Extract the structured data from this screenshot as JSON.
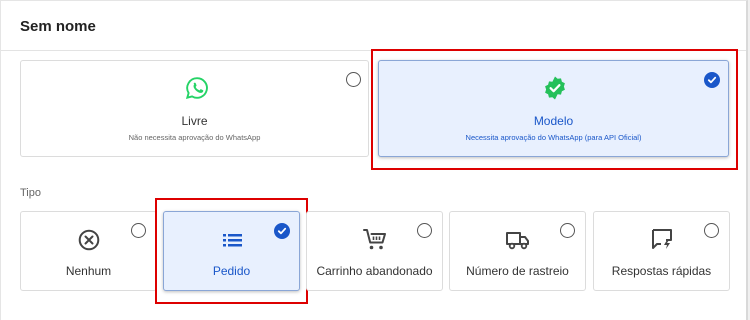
{
  "dialog": {
    "title": "Sem nome"
  },
  "mode_options": [
    {
      "label": "Livre",
      "description": "Não necessita aprovação do WhatsApp",
      "icon": "whatsapp-icon",
      "selected": false
    },
    {
      "label": "Modelo",
      "description": "Necessita aprovação do WhatsApp (para API Oficial)",
      "icon": "verified-badge-icon",
      "selected": true
    }
  ],
  "type_section": {
    "label": "Tipo",
    "options": [
      {
        "label": "Nenhum",
        "icon": "cancel-circle-icon",
        "selected": false
      },
      {
        "label": "Pedido",
        "icon": "list-icon",
        "selected": true
      },
      {
        "label": "Carrinho abandonado",
        "icon": "shopping-cart-icon",
        "selected": false
      },
      {
        "label": "Número de rastreio",
        "icon": "truck-icon",
        "selected": false
      },
      {
        "label": "Respostas rápidas",
        "icon": "quick-reply-icon",
        "selected": false
      }
    ]
  },
  "colors": {
    "accent": "#1a57c9",
    "whatsapp_green": "#25d366",
    "highlight_red": "#dd0000",
    "selected_bg": "#e8f0fe"
  }
}
